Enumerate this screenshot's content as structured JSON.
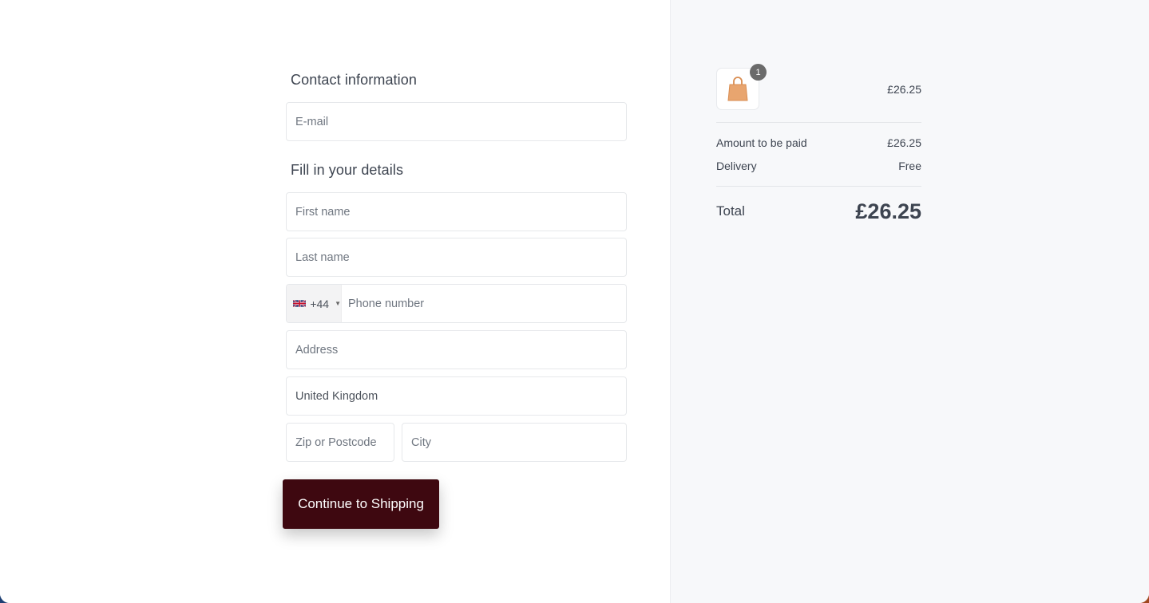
{
  "contact": {
    "title": "Contact information",
    "email_placeholder": "E-mail"
  },
  "details": {
    "title": "Fill in your details",
    "first_name_placeholder": "First name",
    "last_name_placeholder": "Last name",
    "phone": {
      "country_flag": "uk-flag",
      "dial_code": "+44",
      "placeholder": "Phone number"
    },
    "address_placeholder": "Address",
    "country_value": "United Kingdom",
    "zip_placeholder": "Zip or Postcode",
    "city_placeholder": "City"
  },
  "actions": {
    "continue_label": "Continue to Shipping"
  },
  "summary": {
    "item": {
      "icon": "shopping-bag-icon",
      "quantity": "1",
      "price": "£26.25"
    },
    "lines": [
      {
        "label": "Amount to be paid",
        "value": "£26.25"
      },
      {
        "label": "Delivery",
        "value": "Free"
      }
    ],
    "total_label": "Total",
    "total_value": "£26.25"
  },
  "colors": {
    "button_bg": "#3e0810",
    "summary_bg": "#f7f8fa",
    "bag_icon": "#e8a56f",
    "badge_bg": "#6b6b6b"
  }
}
